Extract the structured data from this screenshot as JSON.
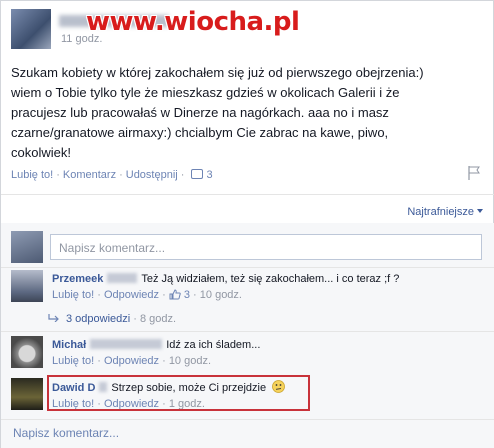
{
  "watermark": "www.wiocha.pl",
  "post": {
    "time": "11 godz.",
    "body": "Szukam kobiety w której zakochałem się już od pierwszego obejrzenia:)\nwiem o Tobie tylko tyle że mieszkasz gdzieś w okolicach Galerii i że\npracujesz lub pracowałaś w Dinerze na nagórkach. aaa no i masz\nczarne/granatowe airmaxy:) chcialbym Cie zabrac na kawe, piwo,\ncokolwiek!",
    "actions": {
      "like": "Lubię to!",
      "comment": "Komentarz",
      "share": "Udostępnij",
      "comment_count": "3"
    }
  },
  "sort_label": "Najtrafniejsze",
  "comment_input_placeholder": "Napisz komentarz...",
  "comments": [
    {
      "name": "Przemeek",
      "text": "Też Ją widziałem, też się zakochałem... i co teraz ;f ?",
      "like": "Lubię to!",
      "reply": "Odpowiedz",
      "likes": "3",
      "time": "10 godz.",
      "replies_label": "3 odpowiedzi",
      "replies_time": "8 godz."
    },
    {
      "name": "Michał",
      "text": "Idź za ich śladem...",
      "like": "Lubię to!",
      "reply": "Odpowiedz",
      "time": "10 godz."
    },
    {
      "name": "Dawid D",
      "text": "Strzep sobie, może Ci przejdzie",
      "like": "Lubię to!",
      "reply": "Odpowiedz",
      "time": "1 godz."
    }
  ],
  "bottom_input_placeholder": "Napisz komentarz...",
  "colors": {
    "link": "#3b5998",
    "highlight_border": "#c8323a",
    "watermark": "#d81c1c"
  }
}
